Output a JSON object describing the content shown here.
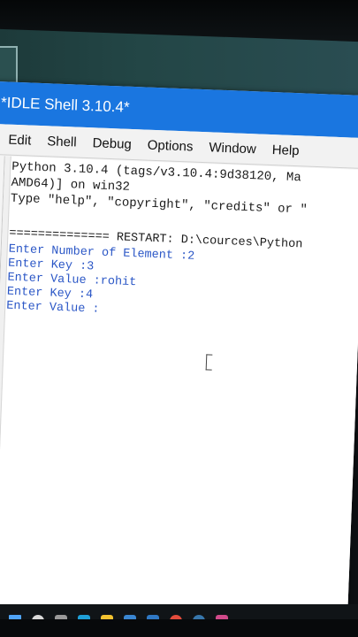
{
  "window": {
    "title": "*IDLE Shell 3.10.4*"
  },
  "menu": [
    "Edit",
    "Shell",
    "Debug",
    "Options",
    "Window",
    "Help"
  ],
  "shell": {
    "banner_line1": "Python 3.10.4 (tags/v3.10.4:9d38120, Ma",
    "banner_line2": "AMD64)] on win32",
    "banner_line3": "Type \"help\", \"copyright\", \"credits\" or \"",
    "restart_rule": "============== RESTART: D:\\cources\\Python",
    "output": [
      "Enter Number of Element :2",
      "Enter Key :3",
      "Enter Value :rohit",
      "Enter Key :4",
      "Enter Value :"
    ]
  },
  "taskbar": {
    "icons": [
      "start-icon",
      "search-icon",
      "task-view-icon",
      "edge-icon",
      "explorer-icon",
      "store-icon",
      "mail-icon",
      "chrome-icon",
      "python-icon",
      "app-icon"
    ],
    "colors": [
      "#4fa3f7",
      "#d9d9d9",
      "#9a9a9a",
      "#1fa0d8",
      "#f2c230",
      "#3a86d1",
      "#2f78c4",
      "#e34c3c",
      "#3776ab",
      "#d04a8a"
    ]
  }
}
